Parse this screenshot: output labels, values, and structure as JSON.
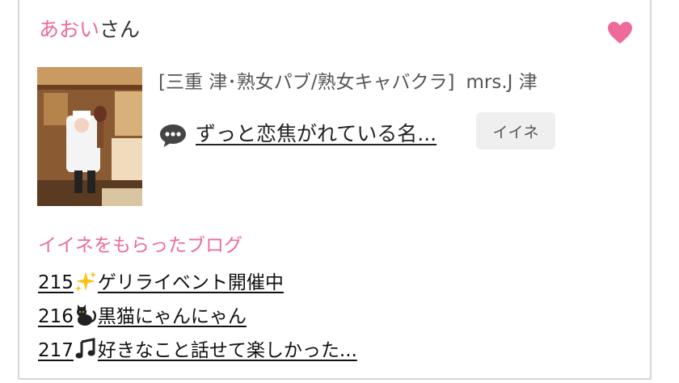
{
  "user": {
    "name": "あおい",
    "suffix": "さん"
  },
  "shop": {
    "region_genre": "[三重 津･熟女パブ/熟女キャバクラ]",
    "name": "mrs.J 津"
  },
  "comment": {
    "text": "ずっと恋焦がれている名..."
  },
  "iine_button": {
    "label": "イイネ"
  },
  "section": {
    "title": "イイネをもらったブログ"
  },
  "blogs": [
    {
      "num": "215",
      "emoji": "sparkles-icon",
      "title": "ゲリライベント開催中"
    },
    {
      "num": "216",
      "emoji": "black-cat-icon",
      "title": "黒猫にゃんにゃん"
    },
    {
      "num": "217",
      "emoji": "music-note-icon",
      "title": "好きなこと話せて楽しかった..."
    }
  ],
  "colors": {
    "accent_pink": "#ec6b9b",
    "button_bg": "#efefef",
    "border": "#d6d6d6"
  }
}
